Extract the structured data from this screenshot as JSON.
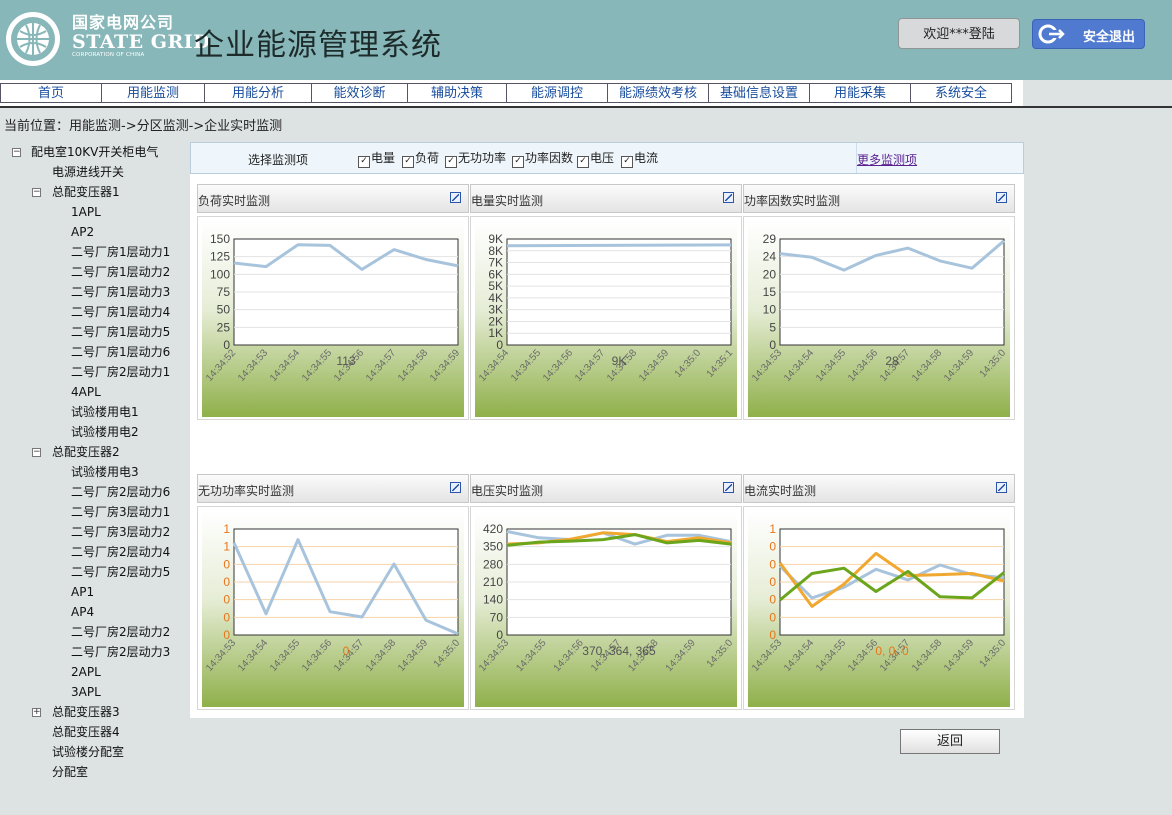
{
  "header": {
    "logo_cn": "国家电网公司",
    "logo_en": "STATE GRID",
    "logo_sub": "CORPORATION OF CHINA",
    "system_title": "企业能源管理系统",
    "welcome": "欢迎***登陆",
    "logout": "安全退出"
  },
  "nav": {
    "items": [
      "首页",
      "用能监测",
      "用能分析",
      "能效诊断",
      "辅助决策",
      "能源调控",
      "能源绩效考核",
      "基础信息设置",
      "用能采集",
      "系统安全"
    ]
  },
  "breadcrumb": "当前位置：用能监测->分区监测->企业实时监测",
  "tree": [
    {
      "label": "配电室10KV开关柜电气",
      "level": 0,
      "toggle": "minus"
    },
    {
      "label": "电源进线开关",
      "level": 1,
      "toggle": ""
    },
    {
      "label": "总配变压器1",
      "level": 1,
      "toggle": "minus"
    },
    {
      "label": "1APL",
      "level": 2,
      "toggle": ""
    },
    {
      "label": "AP2",
      "level": 2,
      "toggle": ""
    },
    {
      "label": "二号厂房1层动力1",
      "level": 2,
      "toggle": ""
    },
    {
      "label": "二号厂房1层动力2",
      "level": 2,
      "toggle": ""
    },
    {
      "label": "二号厂房1层动力3",
      "level": 2,
      "toggle": ""
    },
    {
      "label": "二号厂房1层动力4",
      "level": 2,
      "toggle": ""
    },
    {
      "label": "二号厂房1层动力5",
      "level": 2,
      "toggle": ""
    },
    {
      "label": "二号厂房1层动力6",
      "level": 2,
      "toggle": ""
    },
    {
      "label": "二号厂房2层动力1",
      "level": 2,
      "toggle": ""
    },
    {
      "label": "4APL",
      "level": 2,
      "toggle": ""
    },
    {
      "label": "试验楼用电1",
      "level": 2,
      "toggle": ""
    },
    {
      "label": "试验楼用电2",
      "level": 2,
      "toggle": ""
    },
    {
      "label": "总配变压器2",
      "level": 1,
      "toggle": "minus"
    },
    {
      "label": "试验楼用电3",
      "level": 2,
      "toggle": ""
    },
    {
      "label": "二号厂房2层动力6",
      "level": 2,
      "toggle": ""
    },
    {
      "label": "二号厂房3层动力1",
      "level": 2,
      "toggle": ""
    },
    {
      "label": "二号厂房3层动力2",
      "level": 2,
      "toggle": ""
    },
    {
      "label": "二号厂房2层动力4",
      "level": 2,
      "toggle": ""
    },
    {
      "label": "二号厂房2层动力5",
      "level": 2,
      "toggle": ""
    },
    {
      "label": "AP1",
      "level": 2,
      "toggle": ""
    },
    {
      "label": "AP4",
      "level": 2,
      "toggle": ""
    },
    {
      "label": "二号厂房2层动力2",
      "level": 2,
      "toggle": ""
    },
    {
      "label": "二号厂房2层动力3",
      "level": 2,
      "toggle": ""
    },
    {
      "label": "2APL",
      "level": 2,
      "toggle": ""
    },
    {
      "label": "3APL",
      "level": 2,
      "toggle": ""
    },
    {
      "label": "总配变压器3",
      "level": 1,
      "toggle": "plus"
    },
    {
      "label": "总配变压器4",
      "level": 1,
      "toggle": ""
    },
    {
      "label": "试验楼分配室",
      "level": 1,
      "toggle": ""
    },
    {
      "label": "分配室",
      "level": 1,
      "toggle": ""
    }
  ],
  "filter": {
    "label": "选择监测项",
    "options": [
      "电量",
      "负荷",
      "无功功率",
      "功率因数",
      "电压",
      "电流"
    ],
    "more": "更多监测项"
  },
  "back": "返回",
  "colors": {
    "header_bg": "#88b7b9",
    "line_blue": "#a8c4dc",
    "line_orange": "#f0a830",
    "line_green": "#6aa51c",
    "chart_green": "#8fb04a"
  },
  "chart_data": [
    {
      "type": "line",
      "title": "负荷实时监测",
      "categories": [
        "14:34:52",
        "14:34:53",
        "14:34:54",
        "14:34:55",
        "14:34:56",
        "14:34:57",
        "14:34:58",
        "14:34:59"
      ],
      "y_ticks": [
        "0",
        "25",
        "50",
        "75",
        "100",
        "125",
        "150"
      ],
      "ylim": [
        0,
        150
      ],
      "series": [
        {
          "values": [
            116,
            111,
            142,
            141,
            107,
            135,
            121,
            112
          ],
          "color": "#a8c4dc"
        }
      ],
      "annotation": "113"
    },
    {
      "type": "line",
      "title": "电量实时监测",
      "categories": [
        "14:34:54",
        "14:34:55",
        "14:34:56",
        "14:34:57",
        "14:34:58",
        "14:34:59",
        "14:35:0",
        "14:35:1"
      ],
      "y_ticks": [
        "0",
        "1K",
        "2K",
        "3K",
        "4K",
        "5K",
        "6K",
        "7K",
        "8K",
        "9K"
      ],
      "ylim": [
        0,
        9000
      ],
      "series": [
        {
          "values": [
            8430,
            8440,
            8450,
            8460,
            8470,
            8480,
            8490,
            8500
          ],
          "color": "#a8c4dc"
        }
      ],
      "annotation": "9K"
    },
    {
      "type": "line",
      "title": "功率因数实时监测",
      "categories": [
        "14:34:53",
        "14:34:54",
        "14:34:55",
        "14:34:56",
        "14:34:57",
        "14:34:58",
        "14:34:59",
        "14:35:0"
      ],
      "y_ticks": [
        "0",
        "5",
        "10",
        "15",
        "20",
        "24",
        "29"
      ],
      "ylim": [
        0,
        29
      ],
      "series": [
        {
          "values": [
            25,
            24,
            20.5,
            24.5,
            26.5,
            23,
            21,
            28.5
          ],
          "color": "#a8c4dc"
        }
      ],
      "annotation": "28"
    },
    {
      "type": "line",
      "title": "无功功率实时监测",
      "categories": [
        "14:34:53",
        "14:34:54",
        "14:34:55",
        "14:34:56",
        "14:34:57",
        "14:34:58",
        "14:34:59",
        "14:35:0"
      ],
      "y_ticks": [
        "0",
        "0",
        "0",
        "0",
        "0",
        "1",
        "1"
      ],
      "ylim": [
        0,
        1
      ],
      "series": [
        {
          "values": [
            0.87,
            0.2,
            0.9,
            0.22,
            0.17,
            0.67,
            0.14,
            0.01
          ],
          "color": "#a8c4dc"
        }
      ],
      "annotation": "0"
    },
    {
      "type": "line",
      "title": "电压实时监测",
      "categories": [
        "14:34:53",
        "14:34:55",
        "14:34:56",
        "14:34:57",
        "14:34:58",
        "14:34:59",
        "14:35:0"
      ],
      "y_ticks": [
        "0",
        "70",
        "140",
        "210",
        "280",
        "350",
        "420"
      ],
      "ylim": [
        0,
        420
      ],
      "series": [
        {
          "values": [
            410,
            385,
            378,
            405,
            360,
            395,
            395,
            370
          ],
          "color": "#a8c4dc"
        },
        {
          "values": [
            360,
            365,
            380,
            405,
            398,
            370,
            385,
            365
          ],
          "color": "#f0a830"
        },
        {
          "values": [
            355,
            368,
            372,
            378,
            398,
            365,
            375,
            360
          ],
          "color": "#6aa51c"
        }
      ],
      "annotation": "370, 364, 365"
    },
    {
      "type": "line",
      "title": "电流实时监测",
      "categories": [
        "14:34:53",
        "14:34:54",
        "14:34:55",
        "14:34:56",
        "14:34:57",
        "14:34:58",
        "14:34:59",
        "14:35:0"
      ],
      "y_ticks": [
        "0",
        "0",
        "0",
        "0",
        "0",
        "0",
        "1"
      ],
      "ylim": [
        0,
        1
      ],
      "series": [
        {
          "values": [
            0.65,
            0.35,
            0.45,
            0.62,
            0.52,
            0.66,
            0.57,
            0.54
          ],
          "color": "#a8c4dc"
        },
        {
          "values": [
            0.68,
            0.27,
            0.48,
            0.77,
            0.56,
            0.57,
            0.58,
            0.51
          ],
          "color": "#f0a830"
        },
        {
          "values": [
            0.33,
            0.58,
            0.63,
            0.41,
            0.6,
            0.36,
            0.35,
            0.59
          ],
          "color": "#6aa51c"
        }
      ],
      "annotation": "0, 0, 0"
    }
  ]
}
